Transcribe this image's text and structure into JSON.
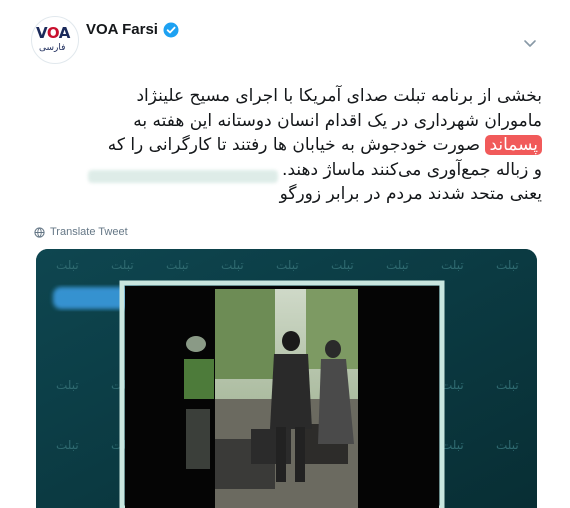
{
  "account": {
    "display_name": "VOA Farsi",
    "verified": true,
    "avatar_mark_v": "V",
    "avatar_mark_o": "O",
    "avatar_mark_a": "A",
    "avatar_sub": "فارسی"
  },
  "tweet": {
    "lines": [
      "بخشی از برنامه تبلت صدای آمریکا با اجرای مسیح علینژاد",
      "ماموران شهرداری در یک اقدام انسان دوستانه این هفته به",
      "صورت خودجوش به خیابان ها رفتند تا کارگرانی را که",
      "و زباله جمع‌آوری می‌کنند ماساژ دهند.",
      "یعنی متحد شدند مردم در برابر زورگو"
    ],
    "highlighted_word": "پسماند"
  },
  "translate_label": "Translate Tweet",
  "media": {
    "watermark_word": "تبلت",
    "colors": {
      "background": "#0b3c44",
      "frame": "#c9e6df",
      "scene_green": "#5f8a4a"
    }
  },
  "colors": {
    "verified_blue": "#1da1f2",
    "highlight": "#f15a5a",
    "text": "#14171a",
    "muted": "#657786"
  }
}
